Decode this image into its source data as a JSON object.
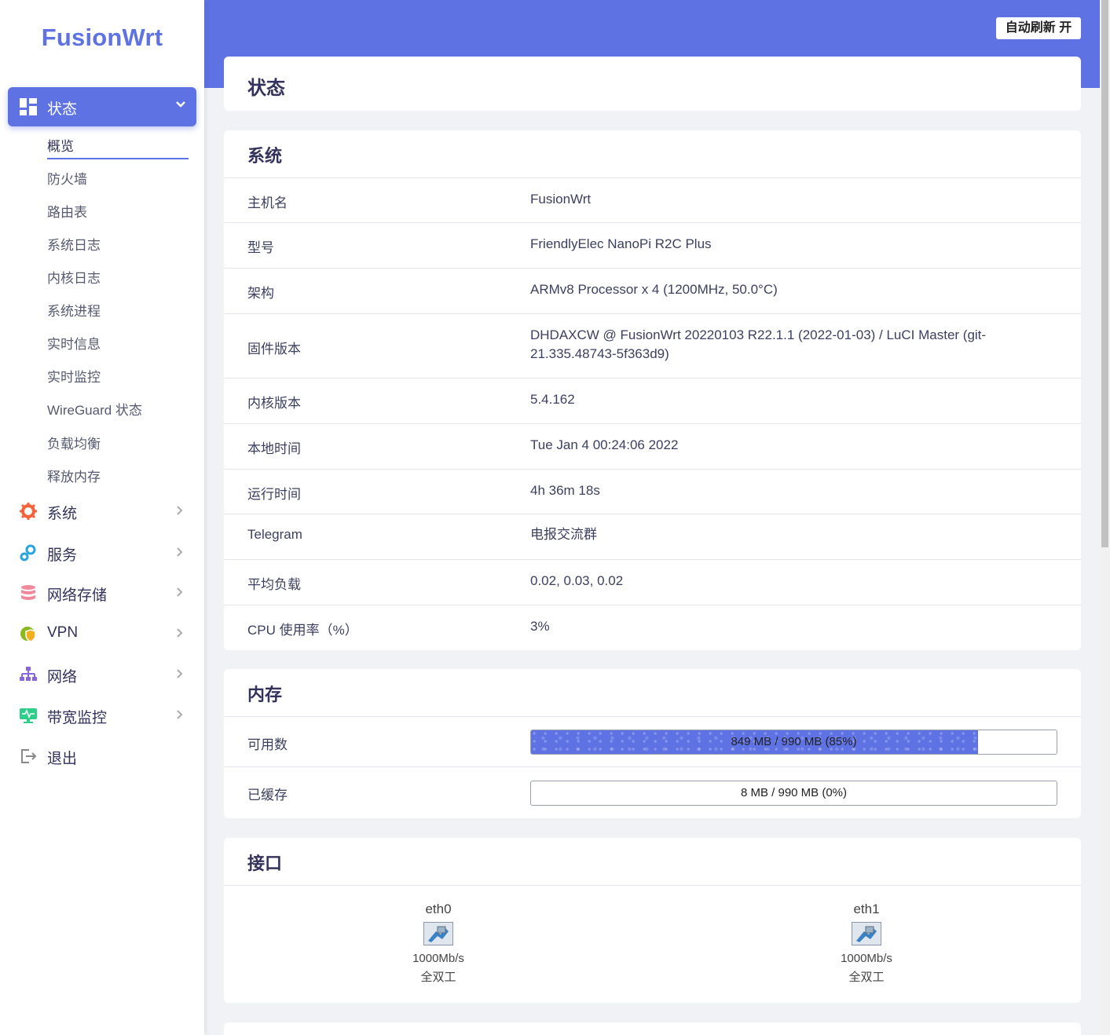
{
  "brand": "FusionWrt",
  "header": {
    "refresh_button": "自动刷新 开"
  },
  "sidebar": {
    "active_menu": "状态",
    "submenu": [
      "概览",
      "防火墙",
      "路由表",
      "系统日志",
      "内核日志",
      "系统进程",
      "实时信息",
      "实时监控",
      "WireGuard 状态",
      "负载均衡",
      "释放内存"
    ],
    "menus": [
      {
        "label": "系统",
        "icon": "gear-icon",
        "color": "#f5633d"
      },
      {
        "label": "服务",
        "icon": "cogs-icon",
        "color": "#2aa3e0"
      },
      {
        "label": "网络存储",
        "icon": "database-icon",
        "color": "#f08a9a"
      },
      {
        "label": "VPN",
        "icon": "globe-shield-icon",
        "color": "#8bb81d"
      },
      {
        "label": "网络",
        "icon": "sitemap-icon",
        "color": "#8965e0"
      },
      {
        "label": "带宽监控",
        "icon": "monitor-icon",
        "color": "#2dce89"
      },
      {
        "label": "退出",
        "icon": "logout-icon",
        "color": "#888"
      }
    ]
  },
  "page_title": "状态",
  "system": {
    "title": "系统",
    "rows": [
      {
        "k": "主机名",
        "v": "FusionWrt"
      },
      {
        "k": "型号",
        "v": "FriendlyElec NanoPi R2C Plus"
      },
      {
        "k": "架构",
        "v": "ARMv8 Processor x 4 (1200MHz, 50.0°C)"
      },
      {
        "k": "固件版本",
        "v": "DHDAXCW @ FusionWrt 20220103 R22.1.1 (2022-01-03) / LuCI Master (git-21.335.48743-5f363d9)"
      },
      {
        "k": "内核版本",
        "v": "5.4.162"
      },
      {
        "k": "本地时间",
        "v": "Tue Jan 4 00:24:06 2022"
      },
      {
        "k": "运行时间",
        "v": "4h 36m 18s"
      },
      {
        "k": "Telegram",
        "v": "电报交流群"
      },
      {
        "k": "平均负载",
        "v": "0.02, 0.03, 0.02"
      },
      {
        "k": "CPU 使用率（%）",
        "v": "3%"
      }
    ]
  },
  "memory": {
    "title": "内存",
    "available": {
      "label": "可用数",
      "text": "849 MB / 990 MB (85%)",
      "fraction": 0.85
    },
    "cached": {
      "label": "已缓存",
      "text": "8 MB / 990 MB (0%)",
      "fraction": 0.0
    }
  },
  "interfaces": {
    "title": "接口",
    "items": [
      {
        "name": "eth0",
        "speed": "1000Mb/s",
        "duplex": "全双工"
      },
      {
        "name": "eth1",
        "speed": "1000Mb/s",
        "duplex": "全双工"
      }
    ]
  }
}
